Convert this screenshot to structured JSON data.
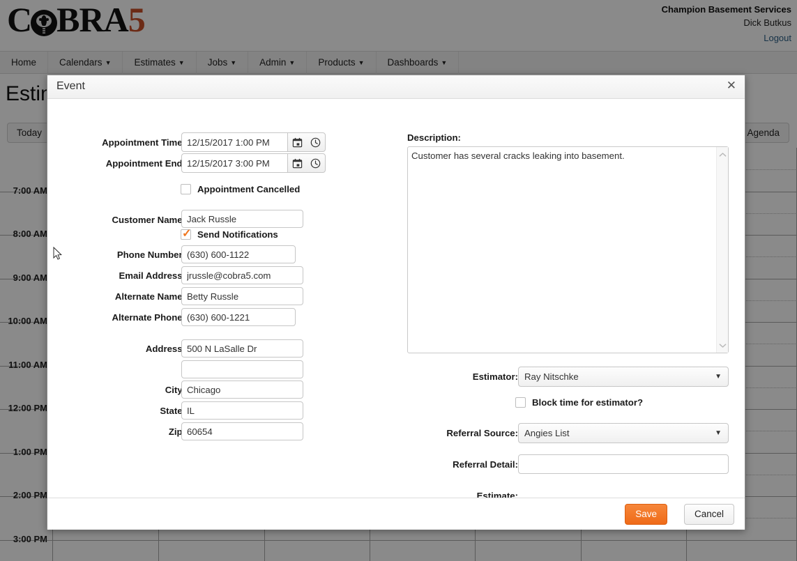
{
  "header": {
    "logo_text_left": "C",
    "logo_text_mid": "BRA",
    "logo_text_five": "5",
    "logo_icon": "cobra-head-icon",
    "company": "Champion Basement Services",
    "username": "Dick Butkus",
    "logout": "Logout"
  },
  "nav": {
    "items": [
      {
        "label": "Home",
        "caret": ""
      },
      {
        "label": "Calendars",
        "caret": "▼"
      },
      {
        "label": "Estimates",
        "caret": "▼"
      },
      {
        "label": "Jobs",
        "caret": "▼"
      },
      {
        "label": "Admin",
        "caret": "▼"
      },
      {
        "label": "Products",
        "caret": "▼"
      },
      {
        "label": "Dashboards",
        "caret": "▼"
      }
    ]
  },
  "page": {
    "title": "Estimates",
    "toolbar": {
      "today": "Today",
      "agenda": "Agenda"
    }
  },
  "calendar": {
    "time_labels": [
      "7:00 AM",
      "8:00 AM",
      "9:00 AM",
      "10:00 AM",
      "11:00 AM",
      "12:00 PM",
      "1:00 PM",
      "2:00 PM",
      "3:00 PM"
    ]
  },
  "modal": {
    "title": "Event",
    "close_icon": "close-icon",
    "left": {
      "appointment_time": {
        "label": "Appointment Time:",
        "value": "12/15/2017 1:00 PM",
        "calendar_icon": "calendar-icon",
        "clock_icon": "clock-icon"
      },
      "appointment_end": {
        "label": "Appointment End:",
        "value": "12/15/2017 3:00 PM",
        "calendar_icon": "calendar-icon",
        "clock_icon": "clock-icon"
      },
      "appointment_cancelled": {
        "label": "Appointment Cancelled",
        "checked": false
      },
      "customer_name": {
        "label": "Customer Name:",
        "value": "Jack Russle"
      },
      "send_notifications": {
        "label": "Send Notifications",
        "checked": true
      },
      "phone_number": {
        "label": "Phone Number:",
        "value": "(630) 600-1122"
      },
      "email_address": {
        "label": "Email Address:",
        "value": "jrussle@cobra5.com"
      },
      "alternate_name": {
        "label": "Alternate Name:",
        "value": "Betty Russle"
      },
      "alternate_phone": {
        "label": "Alternate Phone:",
        "value": "(630) 600-1221"
      },
      "address": {
        "label": "Address:",
        "value": "500 N LaSalle Dr"
      },
      "address2": {
        "label": "",
        "value": ""
      },
      "city": {
        "label": "City:",
        "value": "Chicago"
      },
      "state": {
        "label": "State:",
        "value": "IL"
      },
      "zip": {
        "label": "Zip:",
        "value": "60654"
      }
    },
    "right": {
      "description": {
        "label": "Description:",
        "value": "Customer has several cracks leaking into basement."
      },
      "estimator": {
        "label": "Estimator:",
        "value": "Ray Nitschke",
        "caret": "▼"
      },
      "block_time": {
        "label": "Block time for estimator?",
        "checked": false
      },
      "referral_source": {
        "label": "Referral Source:",
        "value": "Angies List",
        "caret": "▼"
      },
      "referral_detail": {
        "label": "Referral Detail:",
        "value": ""
      },
      "estimate": {
        "label": "Estimate:",
        "value": ""
      }
    },
    "footer": {
      "save": "Save",
      "cancel": "Cancel"
    }
  },
  "colors": {
    "accent_orange": "#ef6b18",
    "logo_orange": "#c8502a",
    "link_blue": "#2b5f86",
    "overlay": "rgba(0,0,0,0.46)"
  }
}
